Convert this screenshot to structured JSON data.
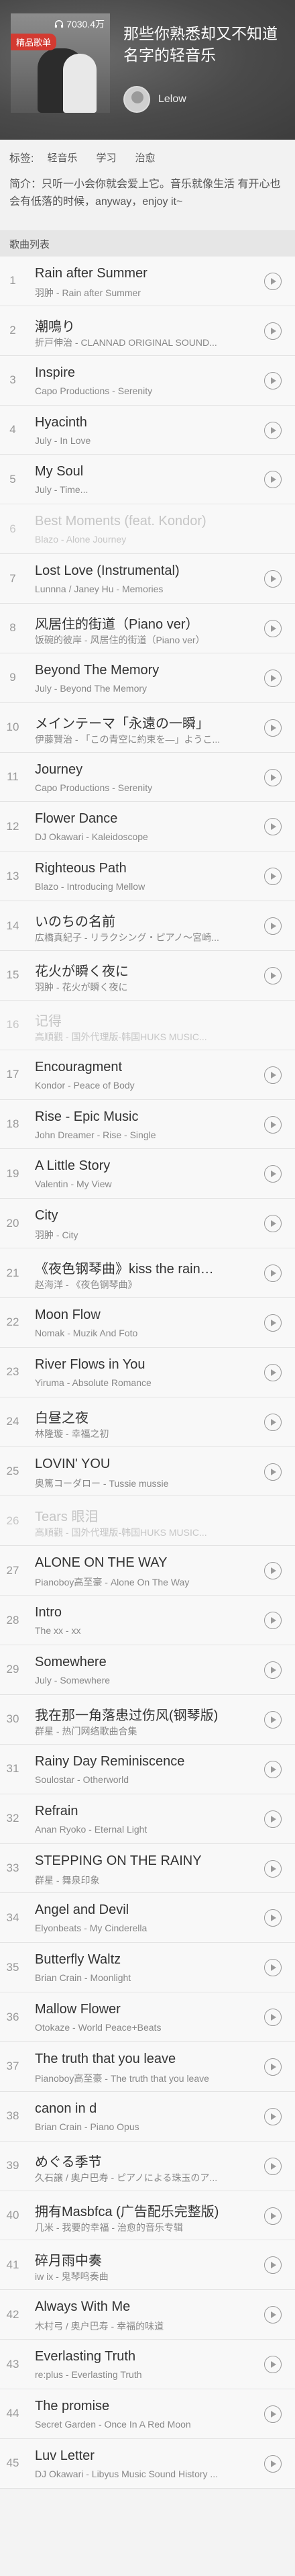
{
  "header": {
    "badge": "精品歌单",
    "plays": "7030.4万",
    "title": "那些你熟悉却又不知道名字的轻音乐",
    "owner": "Lelow"
  },
  "tags": {
    "label": "标签:",
    "items": [
      "轻音乐",
      "学习",
      "治愈"
    ]
  },
  "intro": "简介：只听一小会你就会爱上它。音乐就像生活 有开心也会有低落的时候，anyway，enjoy it~",
  "list_header": "歌曲列表",
  "songs": [
    {
      "n": "1",
      "title": "Rain after Summer",
      "sub": "羽肿 - Rain after Summer",
      "dim": false
    },
    {
      "n": "2",
      "title": "潮鳴り",
      "sub": "折戸伸治 - CLANNAD ORIGINAL SOUND...",
      "dim": false
    },
    {
      "n": "3",
      "title": "Inspire",
      "sub": "Capo Productions - Serenity",
      "dim": false
    },
    {
      "n": "4",
      "title": "Hyacinth",
      "sub": "July - In Love",
      "dim": false
    },
    {
      "n": "5",
      "title": "My Soul",
      "sub": "July - Time...",
      "dim": false
    },
    {
      "n": "6",
      "title": "Best Moments (feat. Kondor)",
      "sub": "Blazo - Alone Journey",
      "dim": true
    },
    {
      "n": "7",
      "title": "Lost Love (Instrumental)",
      "sub": "Lunnna / Janey Hu - Memories",
      "dim": false
    },
    {
      "n": "8",
      "title": "风居住的街道（Piano ver）",
      "sub": "饭碗的彼岸 - 风居住的街道（Piano ver）",
      "dim": false
    },
    {
      "n": "9",
      "title": "Beyond The Memory",
      "sub": "July - Beyond The Memory",
      "dim": false
    },
    {
      "n": "10",
      "title": "メインテーマ「永遠の一瞬」",
      "sub": "伊藤賢治 - 「この青空に約束を―」ようこ...",
      "dim": false
    },
    {
      "n": "11",
      "title": "Journey",
      "sub": "Capo Productions - Serenity",
      "dim": false
    },
    {
      "n": "12",
      "title": "Flower Dance",
      "sub": "DJ Okawari - Kaleidoscope",
      "dim": false
    },
    {
      "n": "13",
      "title": "Righteous Path",
      "sub": "Blazo - Introducing Mellow",
      "dim": false
    },
    {
      "n": "14",
      "title": "いのちの名前",
      "sub": "広橋真紀子 - リラクシング・ピアノ〜宮崎...",
      "dim": false
    },
    {
      "n": "15",
      "title": "花火が瞬く夜に",
      "sub": "羽肿 - 花火が瞬く夜に",
      "dim": false
    },
    {
      "n": "16",
      "title": "记得",
      "sub": "高順觀 - 国外代理版-韩国HUKS MUSIC...",
      "dim": true
    },
    {
      "n": "17",
      "title": "Encouragment",
      "sub": "Kondor - Peace of Body",
      "dim": false
    },
    {
      "n": "18",
      "title": "Rise - Epic Music",
      "sub": "John Dreamer - Rise - Single",
      "dim": false
    },
    {
      "n": "19",
      "title": "A Little Story",
      "sub": "Valentin - My View",
      "dim": false
    },
    {
      "n": "20",
      "title": "City",
      "sub": "羽肿 - City",
      "dim": false
    },
    {
      "n": "21",
      "title": "《夜色钢琴曲》kiss the rain…",
      "sub": "赵海洋 - 《夜色钢琴曲》",
      "dim": false
    },
    {
      "n": "22",
      "title": "Moon Flow",
      "sub": "Nomak - Muzik And Foto",
      "dim": false
    },
    {
      "n": "23",
      "title": "River Flows in You",
      "sub": "Yiruma - Absolute Romance",
      "dim": false
    },
    {
      "n": "24",
      "title": "白昼之夜",
      "sub": "林隆璇 - 幸福之初",
      "dim": false
    },
    {
      "n": "25",
      "title": "LOVIN' YOU",
      "sub": "奥篤コーダロー - Tussie mussie",
      "dim": false
    },
    {
      "n": "26",
      "title": "Tears 眼泪",
      "sub": "高順觀 - 国外代理版-韩国HUKS MUSIC...",
      "dim": true
    },
    {
      "n": "27",
      "title": "ALONE ON THE WAY",
      "sub": "Pianoboy高至豪 - Alone On The Way",
      "dim": false
    },
    {
      "n": "28",
      "title": "Intro",
      "sub": "The xx - xx",
      "dim": false
    },
    {
      "n": "29",
      "title": "Somewhere",
      "sub": "July - Somewhere",
      "dim": false
    },
    {
      "n": "30",
      "title": "我在那一角落患过伤风(钢琴版)",
      "sub": "群星 - 热门网络歌曲合集",
      "dim": false
    },
    {
      "n": "31",
      "title": "Rainy Day Reminiscence",
      "sub": "Soulostar - Otherworld",
      "dim": false
    },
    {
      "n": "32",
      "title": "Refrain",
      "sub": "Anan Ryoko - Eternal Light",
      "dim": false
    },
    {
      "n": "33",
      "title": "STEPPING ON THE RAINY",
      "sub": "群星 - 舞泉印象",
      "dim": false
    },
    {
      "n": "34",
      "title": "Angel and Devil",
      "sub": "Elyonbeats - My Cinderella",
      "dim": false
    },
    {
      "n": "35",
      "title": "Butterfly Waltz",
      "sub": "Brian Crain - Moonlight",
      "dim": false
    },
    {
      "n": "36",
      "title": "Mallow Flower",
      "sub": "Otokaze - World Peace+Beats",
      "dim": false
    },
    {
      "n": "37",
      "title": "The truth that you leave",
      "sub": "Pianoboy高至豪 - The truth that you leave",
      "dim": false
    },
    {
      "n": "38",
      "title": "canon in d",
      "sub": "Brian Crain - Piano Opus",
      "dim": false
    },
    {
      "n": "39",
      "title": "めぐる季节",
      "sub": "久石譲 / 奥户巴寿 - ピアノによる珠玉のア...",
      "dim": false
    },
    {
      "n": "40",
      "title": "拥有Masbfca (广告配乐完整版)",
      "sub": "几米 - 我要的幸福 - 治愈的音乐专辑",
      "dim": false
    },
    {
      "n": "41",
      "title": "碎月雨中奏",
      "sub": "iw ix - 鬼琴鸣奏曲",
      "dim": false
    },
    {
      "n": "42",
      "title": "Always With Me",
      "sub": "木村弓 / 奥户巴寿 - 幸福的味道",
      "dim": false
    },
    {
      "n": "43",
      "title": "Everlasting Truth",
      "sub": "re:plus - Everlasting Truth",
      "dim": false
    },
    {
      "n": "44",
      "title": "The promise",
      "sub": "Secret Garden - Once In A Red Moon",
      "dim": false
    },
    {
      "n": "45",
      "title": "Luv Letter",
      "sub": "DJ Okawari - Libyus Music Sound History ...",
      "dim": false
    }
  ]
}
